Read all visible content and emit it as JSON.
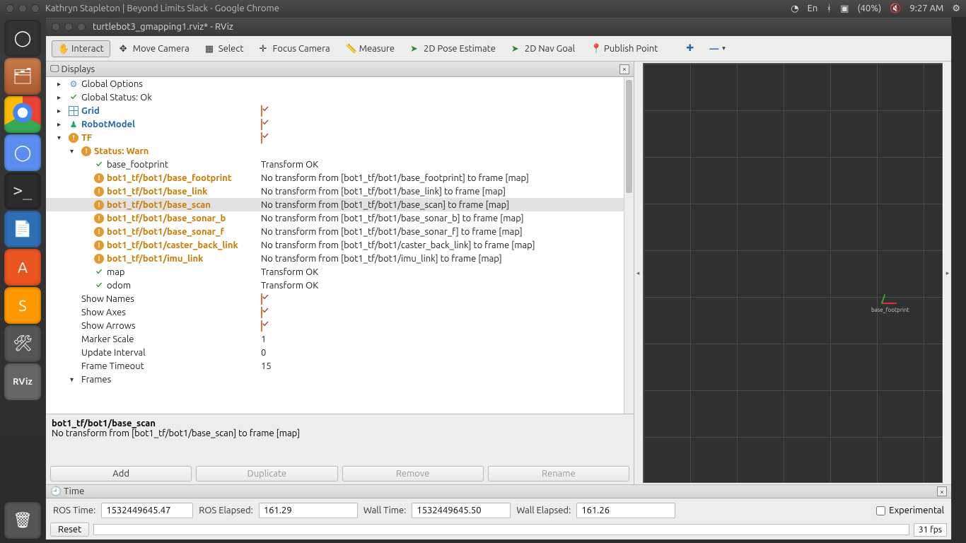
{
  "system": {
    "chrome_title": "Kathryn Stapleton | Beyond Limits Slack - Google Chrome",
    "lang": "En",
    "battery": "(40%)",
    "time": "9:27 AM"
  },
  "rviz": {
    "title": "turtlebot3_gmapping1.rviz* - RViz",
    "toolbar": {
      "interact": "Interact",
      "move_camera": "Move Camera",
      "select": "Select",
      "focus_camera": "Focus Camera",
      "measure": "Measure",
      "pose_estimate": "2D Pose Estimate",
      "nav_goal": "2D Nav Goal",
      "publish_point": "Publish Point"
    },
    "displays_title": "Displays",
    "tree": {
      "global_options": "Global Options",
      "global_status": "Global Status: Ok",
      "grid": "Grid",
      "robot_model": "RobotModel",
      "tf": "TF",
      "status_warn": "Status: Warn",
      "frames": [
        {
          "name": "base_footprint",
          "ok": true,
          "msg": "Transform OK"
        },
        {
          "name": "bot1_tf/bot1/base_footprint",
          "ok": false,
          "msg": "No transform from [bot1_tf/bot1/base_footprint] to frame [map]"
        },
        {
          "name": "bot1_tf/bot1/base_link",
          "ok": false,
          "msg": "No transform from [bot1_tf/bot1/base_link] to frame [map]"
        },
        {
          "name": "bot1_tf/bot1/base_scan",
          "ok": false,
          "msg": "No transform from [bot1_tf/bot1/base_scan] to frame [map]",
          "sel": true
        },
        {
          "name": "bot1_tf/bot1/base_sonar_b",
          "ok": false,
          "msg": "No transform from [bot1_tf/bot1/base_sonar_b] to frame [map]"
        },
        {
          "name": "bot1_tf/bot1/base_sonar_f",
          "ok": false,
          "msg": "No transform from [bot1_tf/bot1/base_sonar_f] to frame [map]"
        },
        {
          "name": "bot1_tf/bot1/caster_back_link",
          "ok": false,
          "msg": "No transform from [bot1_tf/bot1/caster_back_link] to frame [map]"
        },
        {
          "name": "bot1_tf/bot1/imu_link",
          "ok": false,
          "msg": "No transform from [bot1_tf/bot1/imu_link] to frame [map]"
        },
        {
          "name": "map",
          "ok": true,
          "msg": "Transform OK"
        },
        {
          "name": "odom",
          "ok": true,
          "msg": "Transform OK"
        }
      ],
      "show_names": "Show Names",
      "show_axes": "Show Axes",
      "show_arrows": "Show Arrows",
      "marker_scale": {
        "label": "Marker Scale",
        "val": "1"
      },
      "update_interval": {
        "label": "Update Interval",
        "val": "0"
      },
      "frame_timeout": {
        "label": "Frame Timeout",
        "val": "15"
      },
      "frames_label": "Frames"
    },
    "desc": {
      "title": "bot1_tf/bot1/base_scan",
      "body": "No transform from [bot1_tf/bot1/base_scan] to frame [map]"
    },
    "buttons": {
      "add": "Add",
      "dup": "Duplicate",
      "rem": "Remove",
      "ren": "Rename"
    },
    "origin_label": "base_footprint",
    "time": {
      "title": "Time",
      "ros_time_l": "ROS Time:",
      "ros_time": "1532449645.47",
      "ros_elapsed_l": "ROS Elapsed:",
      "ros_elapsed": "161.29",
      "wall_time_l": "Wall Time:",
      "wall_time": "1532449645.50",
      "wall_elapsed_l": "Wall Elapsed:",
      "wall_elapsed": "161.26",
      "experimental": "Experimental",
      "reset": "Reset",
      "fps": "31 fps"
    }
  }
}
